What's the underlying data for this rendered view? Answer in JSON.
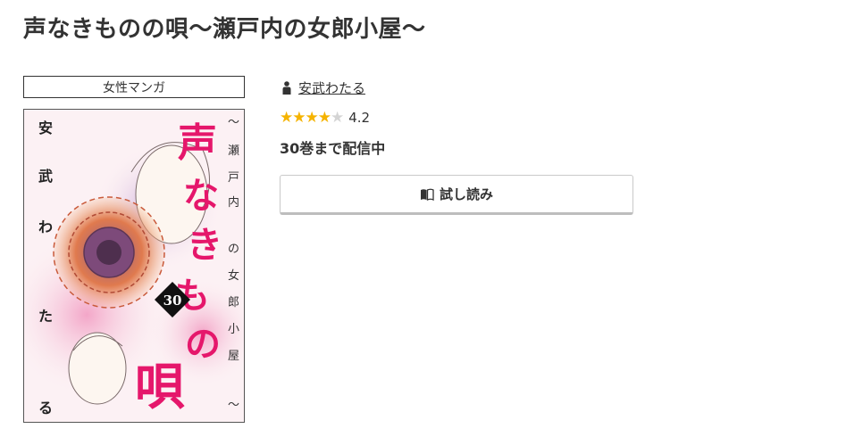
{
  "book": {
    "title": "声なきものの唄～瀬戸内の女郎小屋～",
    "genre": "女性マンガ",
    "author": "安武わたる",
    "rating": 4.2,
    "rating_label": "4.2",
    "stars": {
      "filled": 4,
      "total": 5
    },
    "volumes_status": "30巻まで配信中"
  },
  "actions": {
    "trial_label": "試し読み"
  },
  "cover": {
    "title_text": "声なきものの唄",
    "subtitle_text": "～瀬戸内の女郎小屋～",
    "author_text": "安武わたる",
    "volume_number": "30"
  },
  "colors": {
    "text": "#333333",
    "star_on": "#f5b300",
    "star_off": "#d4d4d4",
    "cover_title": "#e5176b"
  },
  "icons": {
    "author": "person-icon",
    "trial": "open-book-icon"
  }
}
